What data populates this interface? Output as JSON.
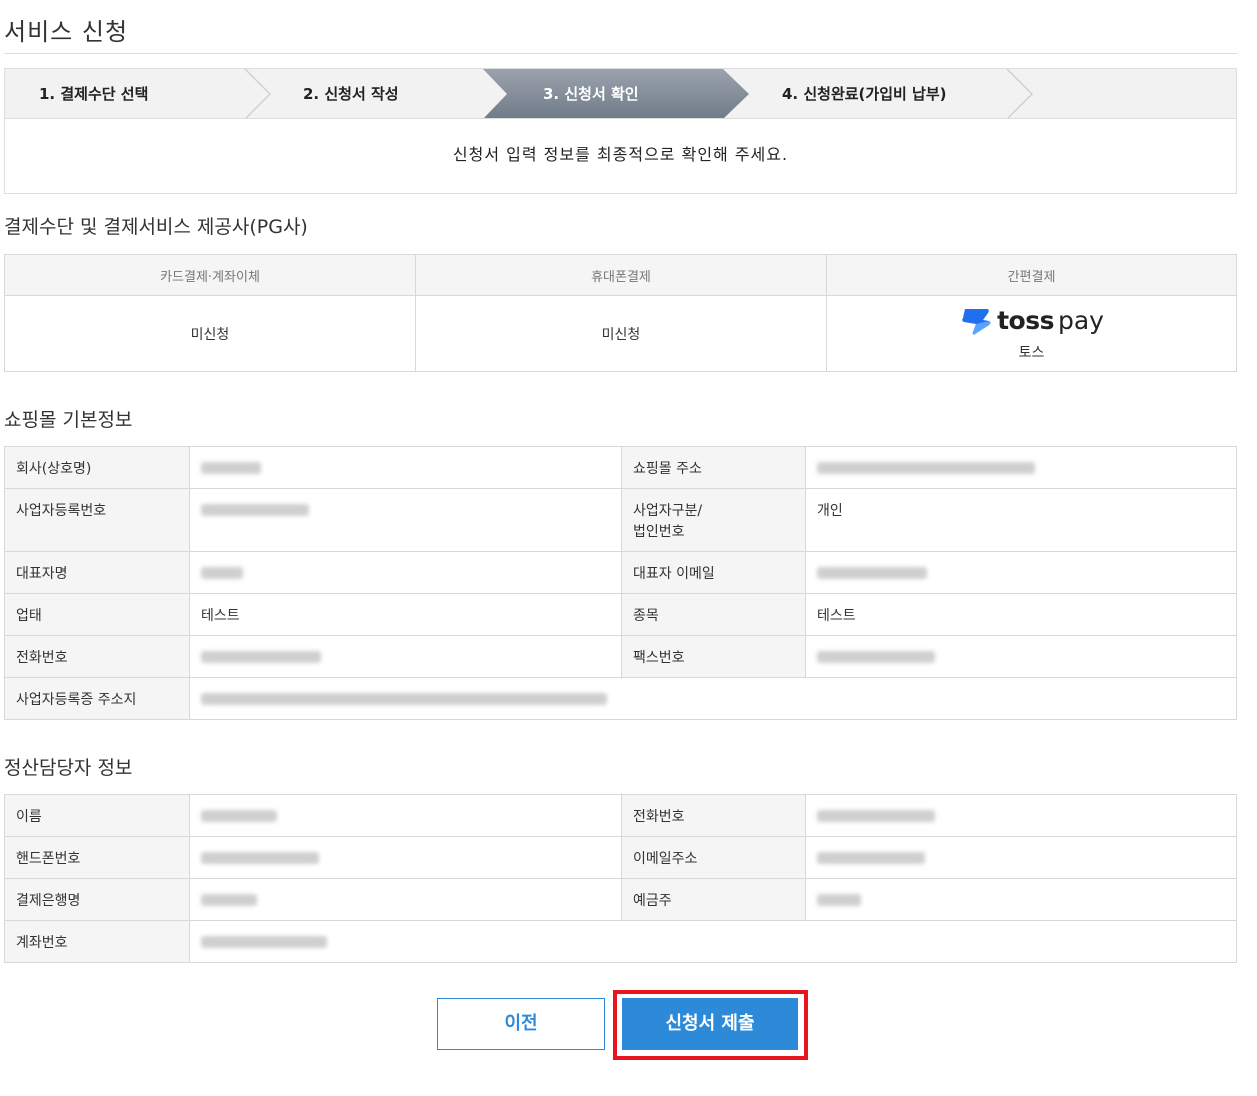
{
  "page": {
    "title": "서비스 신청"
  },
  "steps": [
    {
      "label": "1. 결제수단 선택",
      "active": false
    },
    {
      "label": "2. 신청서 작성",
      "active": false
    },
    {
      "label": "3. 신청서 확인",
      "active": true
    },
    {
      "label": "4. 신청완료(가입비 납부)",
      "active": false
    }
  ],
  "step_message": "신청서 입력 정보를 최종적으로 확인해 주세요.",
  "pg_section": {
    "title": "결제수단 및 결제서비스 제공사(PG사)",
    "headers": [
      "카드결제·계좌이체",
      "휴대폰결제",
      "간편결제"
    ],
    "card": "미신청",
    "phone": "미신청",
    "easy_logo_a": "toss",
    "easy_logo_b": "pay",
    "easy_name": "토스"
  },
  "shop_section": {
    "title": "쇼핑몰 기본정보",
    "company_label": "회사(상호명)",
    "shop_url_label": "쇼핑몰 주소",
    "biz_no_label": "사업자등록번호",
    "biz_type_label_1": "사업자구분/",
    "biz_type_label_2": "법인번호",
    "biz_type_value": "개인",
    "ceo_label": "대표자명",
    "ceo_email_label": "대표자 이메일",
    "business_label": "업태",
    "business_value": "테스트",
    "item_label": "종목",
    "item_value": "테스트",
    "phone_label": "전화번호",
    "fax_label": "팩스번호",
    "address_label": "사업자등록증 주소지"
  },
  "settle_section": {
    "title": "정산담당자 정보",
    "name_label": "이름",
    "phone_label": "전화번호",
    "mobile_label": "핸드폰번호",
    "email_label": "이메일주소",
    "bank_label": "결제은행명",
    "holder_label": "예금주",
    "account_label": "계좌번호"
  },
  "buttons": {
    "prev": "이전",
    "submit": "신청서 제출"
  },
  "colors": {
    "accent": "#2c8ad8",
    "highlight": "#e8141e",
    "active_step": "#7e8794",
    "toss_blue": "#1f6fee"
  }
}
